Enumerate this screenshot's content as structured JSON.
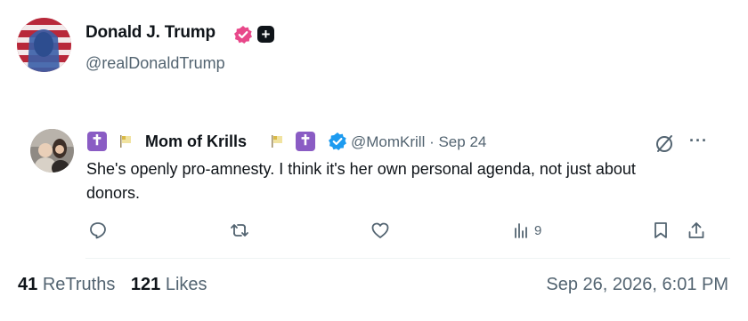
{
  "post": {
    "author_name": "Donald J. Trump",
    "author_handle": "@realDonaldTrump"
  },
  "quoted": {
    "author_name": "Mom of Krills",
    "handle_date": "@MomKrill · Sep 24",
    "text": "She's openly pro-amnesty. I think it's her own personal agenda, not just about donors.",
    "cross_badge": "✝",
    "views": "9"
  },
  "stats": {
    "retruths_count": "41",
    "retruths_label": "ReTruths",
    "likes_count": "121",
    "likes_label": "Likes"
  },
  "timestamp": "Sep 26, 2026, 6:01 PM",
  "colors": {
    "verified": "#e8488a",
    "blue_check": "#1d9bf0",
    "cross_badge": "#8a5cc4",
    "muted": "#536471"
  },
  "icons": {
    "reply": "reply-icon",
    "repost": "repost-icon",
    "like": "heart-icon",
    "views": "views-icon",
    "bookmark": "bookmark-icon",
    "share": "share-icon",
    "grok": "grok-icon",
    "more": "more-icon"
  }
}
